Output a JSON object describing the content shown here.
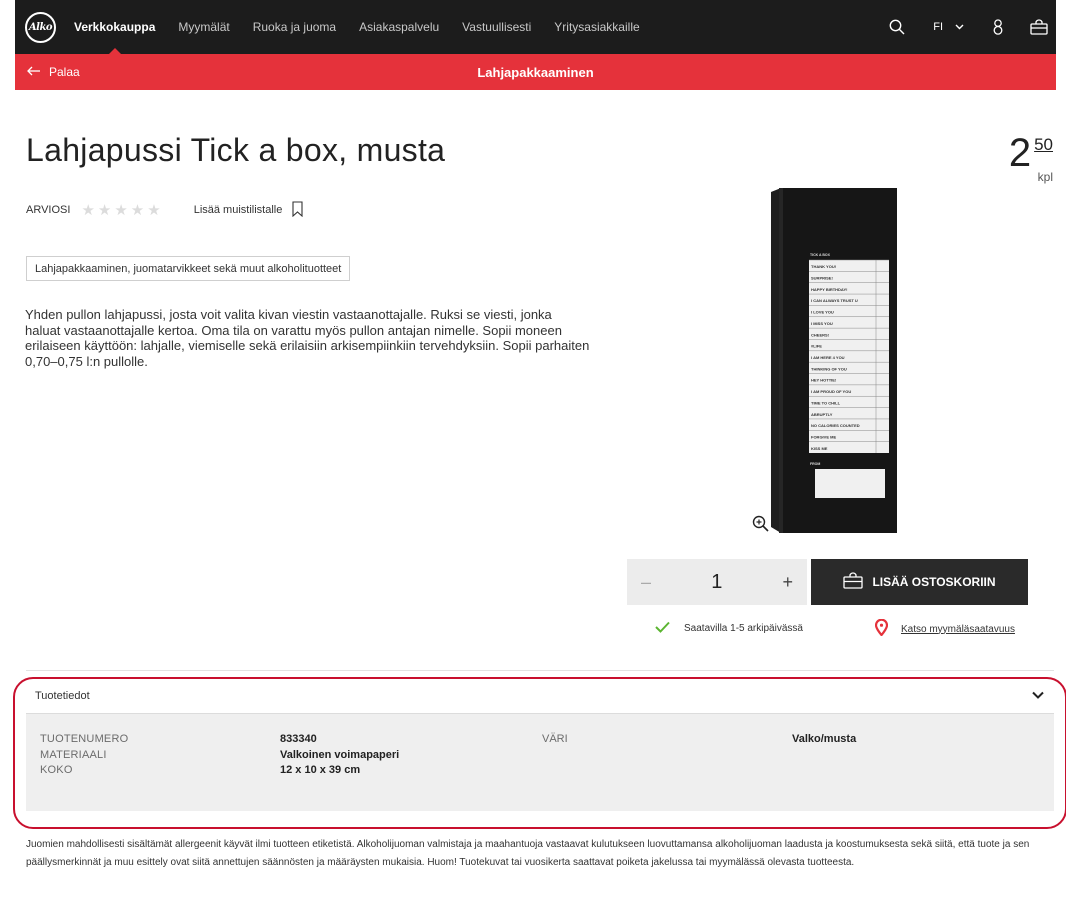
{
  "header": {
    "logo_text": "Alko",
    "nav": [
      {
        "label": "Verkkokauppa",
        "active": true
      },
      {
        "label": "Myymälät",
        "active": false
      },
      {
        "label": "Ruoka ja juoma",
        "active": false
      },
      {
        "label": "Asiakaspalvelu",
        "active": false
      },
      {
        "label": "Vastuullisesti",
        "active": false
      },
      {
        "label": "Yritysasiakkaille",
        "active": false
      }
    ],
    "language": "FI"
  },
  "subheader": {
    "back_label": "Palaa",
    "title": "Lahjapakkaaminen"
  },
  "product": {
    "title": "Lahjapussi Tick a box, musta",
    "price_int": "2",
    "price_dec": "50",
    "price_unit": "kpl",
    "rating_label": "ARVIOSI",
    "rating_value": 0,
    "rating_max": 5,
    "wishlist_label": "Lisää muistilistalle",
    "category": "Lahjapakkaaminen, juomatarvikkeet sekä muut alkoholituotteet",
    "description": "Yhden pullon lahjapussi, josta voit valita kivan viestin vastaanottajalle. Ruksi se viesti, jonka haluat vastaanottajalle kertoa. Oma tila on varattu myös pullon antajan nimelle. Sopii moneen erilaiseen käyttöön: lahjalle, viemiselle sekä erilaisiin arkisempiinkiin tervehdyksiin. Sopii parhaiten 0,70–0,75 l:n pullolle.",
    "bag_print": {
      "header": "TICK A BOX",
      "lines": [
        "THANK YOU!",
        "SURPRISE!",
        "HAPPY BIRTHDAY!",
        "I CAN ALWAYS TRUST U",
        "I LOVE YOU",
        "I MISS YOU",
        "CHEERS!",
        "#LIFE",
        "I AM HERE 4 YOU",
        "THINKING OF YOU",
        "HEY HOTTIE!",
        "I AM PROUD OF YOU",
        "TIME TO CHILL",
        "ABRUPTLY",
        "NO CALORIES COUNTED",
        "FORGIVE ME",
        "KISS ME"
      ],
      "from_label": "FROM"
    }
  },
  "purchase": {
    "quantity": "1",
    "minus": "–",
    "plus": "+",
    "cart_label": "LISÄÄ OSTOSKORIIN",
    "availability": "Saatavilla 1-5 arkipäivässä",
    "store_availability": "Katso myymäläsaatavuus",
    "accent_color": "#e5323b",
    "check_color": "#5bb531"
  },
  "details": {
    "header": "Tuotetiedot",
    "rows": [
      {
        "label": "TUOTENUMERO",
        "value": "833340",
        "label2": "VÄRI",
        "value2": "Valko/musta"
      },
      {
        "label": "MATERIAALI",
        "value": "Valkoinen voimapaperi",
        "label2": "",
        "value2": ""
      },
      {
        "label": "KOKO",
        "value": "12 x 10 x 39 cm",
        "label2": "",
        "value2": ""
      }
    ]
  },
  "disclaimer": "Juomien mahdollisesti sisältämät allergeenit käyvät ilmi tuotteen etiketistä. Alkoholijuoman valmistaja ja maahantuoja vastaavat kulutukseen luovuttamansa alkoholijuoman laadusta ja koostumuksesta sekä siitä, että tuote ja sen päällysmerkinnät ja muu esittely ovat siitä annettujen säännösten ja määräysten mukaisia. Huom! Tuotekuvat tai vuosikerta saattavat poiketa jakelussa tai myymälässä olevasta tuotteesta."
}
